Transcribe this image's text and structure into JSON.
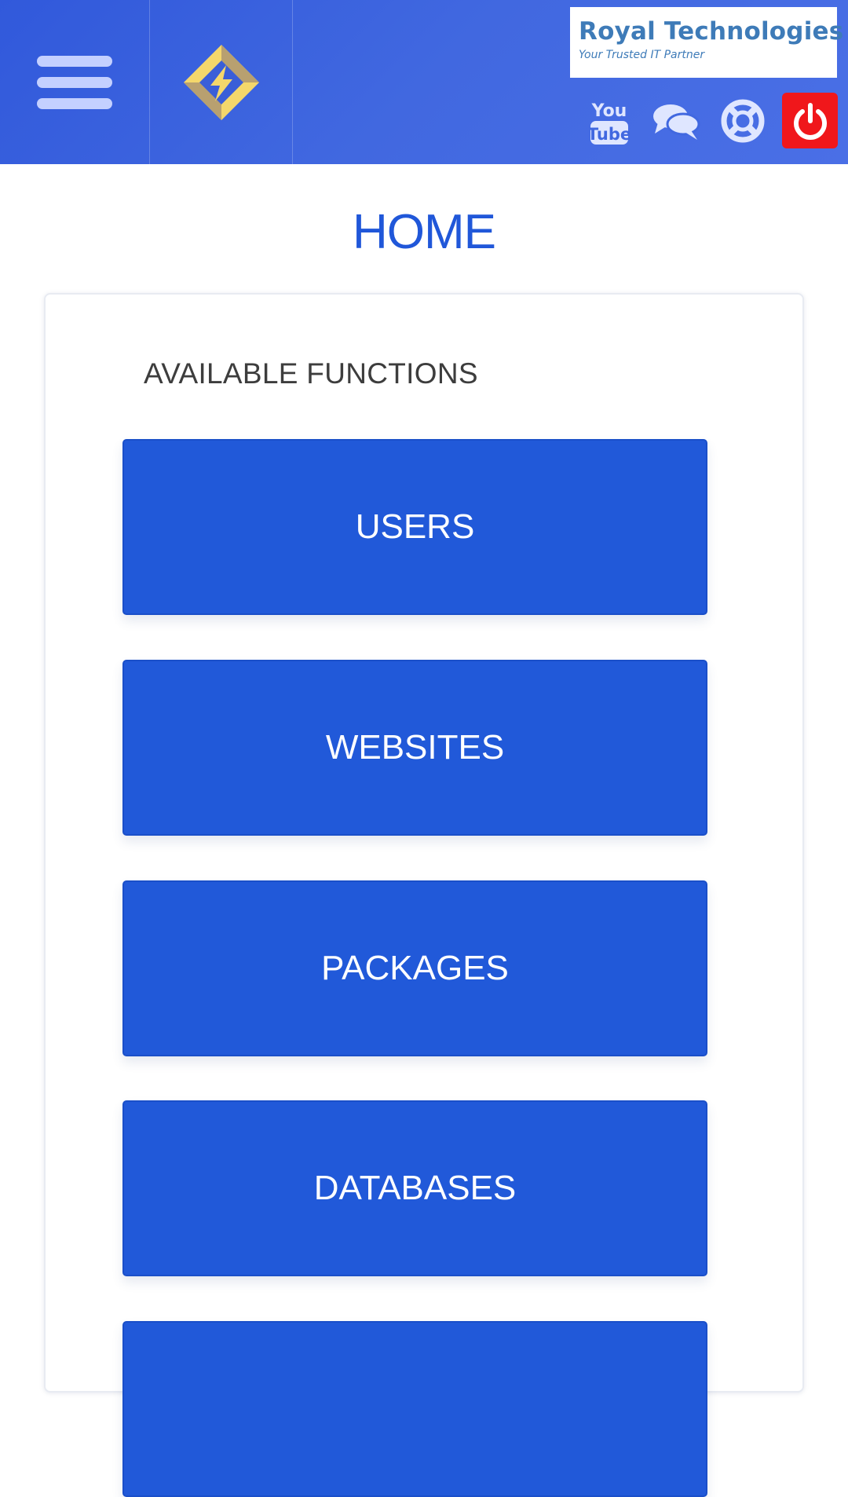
{
  "header": {
    "menu_icon": "hamburger-menu-icon",
    "app_logo_icon": "diamond-lightning-logo-icon",
    "brand": {
      "name": "Royal  Technologies",
      "tagline": "Your Trusted IT Partner"
    },
    "icons": {
      "youtube": "youtube-icon",
      "chat": "chat-bubbles-icon",
      "help": "lifebuoy-icon",
      "power": "power-icon"
    },
    "youtube_text": {
      "top": "You",
      "bottom": "Tube"
    }
  },
  "page": {
    "title": "HOME"
  },
  "card": {
    "heading": "AVAILABLE FUNCTIONS",
    "buttons": [
      {
        "label": "USERS"
      },
      {
        "label": "WEBSITES"
      },
      {
        "label": "PACKAGES"
      },
      {
        "label": "DATABASES"
      },
      {
        "label": ""
      }
    ]
  },
  "colors": {
    "header": "#4168e0",
    "accent_blue": "#2159d9",
    "title_blue": "#2057d9",
    "power_red": "#f0171b",
    "brand_text": "#3e7bb8"
  }
}
